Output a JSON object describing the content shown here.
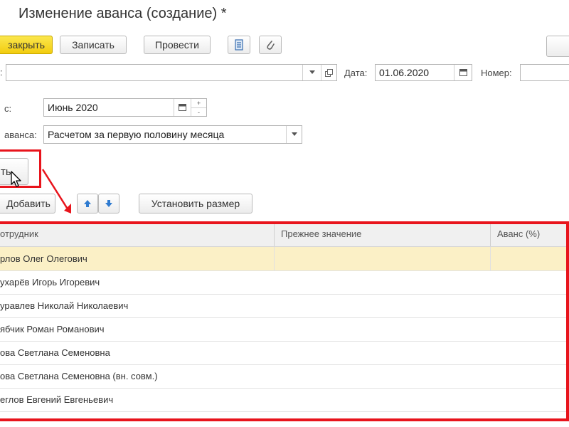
{
  "window": {
    "title": "Изменение аванса (создание) *"
  },
  "toolbar": {
    "close_label": "закрыть",
    "save_label": "Записать",
    "post_label": "Провести"
  },
  "form": {
    "date_label": "Дата:",
    "date_value": "01.06.2020",
    "number_label": "Номер:",
    "month_label": "с:",
    "month_value": "Июнь 2020",
    "advance_label": "аванса:",
    "advance_value": "Расчетом за первую половину месяца",
    "fill_button": "ть"
  },
  "table_toolbar": {
    "add_label": "Добавить",
    "set_size_label": "Установить размер"
  },
  "table": {
    "columns": [
      "отрудник",
      "Прежнее значение",
      "Аванс (%)"
    ],
    "rows": [
      [
        "рлов Олег Олегович",
        "",
        ""
      ],
      [
        "ухарёв Игорь Игоревич",
        "",
        ""
      ],
      [
        "уравлев Николай Николаевич",
        "",
        ""
      ],
      [
        "ябчик Роман Романович",
        "",
        ""
      ],
      [
        "ова Светлана Семеновна",
        "",
        ""
      ],
      [
        "ова Светлана Семеновна (вн. совм.)",
        "",
        ""
      ],
      [
        "еглов Евгений Евгеньевич",
        "",
        ""
      ]
    ]
  },
  "colors": {
    "highlight": "#e8141c",
    "primary_button": "#f5d417",
    "selected_row": "#fbf0c6"
  }
}
